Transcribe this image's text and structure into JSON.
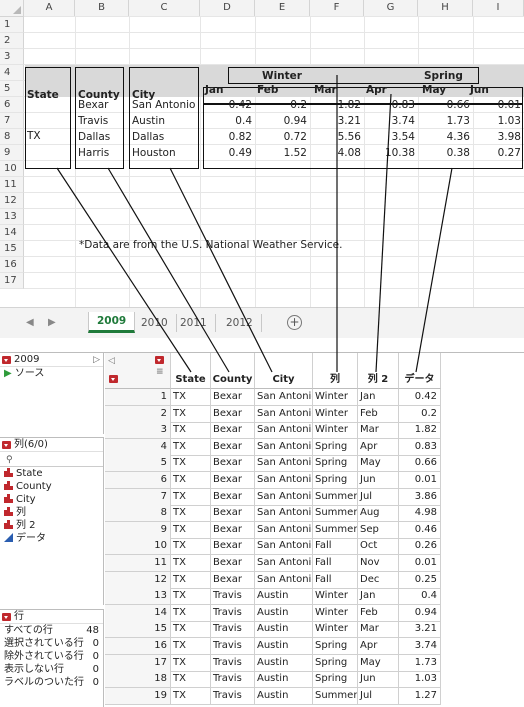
{
  "sheet": {
    "columns": [
      "A",
      "B",
      "C",
      "D",
      "E",
      "F",
      "G",
      "H",
      "I"
    ],
    "rows": [
      "1",
      "2",
      "3",
      "4",
      "5",
      "6",
      "7",
      "8",
      "9",
      "10",
      "11",
      "12",
      "13",
      "14",
      "15",
      "16",
      "17"
    ],
    "header_state": "State",
    "header_county": "County",
    "header_city": "City",
    "season_winter": "Winter",
    "season_spring": "Spring",
    "months": [
      "Jan",
      "Feb",
      "Mar",
      "Apr",
      "May",
      "Jun"
    ],
    "state_value": "TX",
    "records": [
      {
        "county": "Bexar",
        "city": "San Antonio",
        "values": [
          "0.42",
          "0.2",
          "1.82",
          "0.83",
          "0.66",
          "0.01"
        ]
      },
      {
        "county": "Travis",
        "city": "Austin",
        "values": [
          "0.4",
          "0.94",
          "3.21",
          "3.74",
          "1.73",
          "1.03"
        ]
      },
      {
        "county": "Dallas",
        "city": "Dallas",
        "values": [
          "0.82",
          "0.72",
          "5.56",
          "3.54",
          "4.36",
          "3.98"
        ]
      },
      {
        "county": "Harris",
        "city": "Houston",
        "values": [
          "0.49",
          "1.52",
          "4.08",
          "10.38",
          "0.38",
          "0.27"
        ]
      }
    ],
    "note": "*Data are from the U.S. National Weather Service.",
    "tabs": [
      "2009",
      "2010",
      "2011",
      "2012"
    ],
    "active_tab": "2009",
    "add_tab_symbol": "+"
  },
  "jmp": {
    "table_name": "2009",
    "source_label": "ソース",
    "columns_panel_title": "列(6/0)",
    "column_list": [
      {
        "name": "State",
        "type": "nominal"
      },
      {
        "name": "County",
        "type": "nominal"
      },
      {
        "name": "City",
        "type": "nominal"
      },
      {
        "name": "列",
        "type": "nominal"
      },
      {
        "name": "列 2",
        "type": "nominal"
      },
      {
        "name": "データ",
        "type": "continuous"
      }
    ],
    "rows_panel_title": "行",
    "row_stats": [
      {
        "label": "すべての行",
        "value": "48"
      },
      {
        "label": "選択されている行",
        "value": "0"
      },
      {
        "label": "除外されている行",
        "value": "0"
      },
      {
        "label": "表示しない行",
        "value": "0"
      },
      {
        "label": "ラベルのついた行",
        "value": "0"
      }
    ],
    "grid_headers": [
      "State",
      "County",
      "City",
      "列",
      "列 2",
      "データ"
    ],
    "grid_rows": [
      [
        "1",
        "TX",
        "Bexar",
        "San Antonio",
        "Winter",
        "Jan",
        "0.42"
      ],
      [
        "2",
        "TX",
        "Bexar",
        "San Antonio",
        "Winter",
        "Feb",
        "0.2"
      ],
      [
        "3",
        "TX",
        "Bexar",
        "San Antonio",
        "Winter",
        "Mar",
        "1.82"
      ],
      [
        "4",
        "TX",
        "Bexar",
        "San Antonio",
        "Spring",
        "Apr",
        "0.83"
      ],
      [
        "5",
        "TX",
        "Bexar",
        "San Antonio",
        "Spring",
        "May",
        "0.66"
      ],
      [
        "6",
        "TX",
        "Bexar",
        "San Antonio",
        "Spring",
        "Jun",
        "0.01"
      ],
      [
        "7",
        "TX",
        "Bexar",
        "San Antonio",
        "Summer",
        "Jul",
        "3.86"
      ],
      [
        "8",
        "TX",
        "Bexar",
        "San Antonio",
        "Summer",
        "Aug",
        "4.98"
      ],
      [
        "9",
        "TX",
        "Bexar",
        "San Antonio",
        "Summer",
        "Sep",
        "0.46"
      ],
      [
        "10",
        "TX",
        "Bexar",
        "San Antonio",
        "Fall",
        "Oct",
        "0.26"
      ],
      [
        "11",
        "TX",
        "Bexar",
        "San Antonio",
        "Fall",
        "Nov",
        "0.01"
      ],
      [
        "12",
        "TX",
        "Bexar",
        "San Antonio",
        "Fall",
        "Dec",
        "0.25"
      ],
      [
        "13",
        "TX",
        "Travis",
        "Austin",
        "Winter",
        "Jan",
        "0.4"
      ],
      [
        "14",
        "TX",
        "Travis",
        "Austin",
        "Winter",
        "Feb",
        "0.94"
      ],
      [
        "15",
        "TX",
        "Travis",
        "Austin",
        "Winter",
        "Mar",
        "3.21"
      ],
      [
        "16",
        "TX",
        "Travis",
        "Austin",
        "Spring",
        "Apr",
        "3.74"
      ],
      [
        "17",
        "TX",
        "Travis",
        "Austin",
        "Spring",
        "May",
        "1.73"
      ],
      [
        "18",
        "TX",
        "Travis",
        "Austin",
        "Spring",
        "Jun",
        "1.03"
      ],
      [
        "19",
        "TX",
        "Travis",
        "Austin",
        "Summer",
        "Jul",
        "1.27"
      ]
    ]
  },
  "colors": {
    "accent_green": "#1f7a3a",
    "nominal_red": "#c0282d",
    "continuous_blue": "#2a5db0",
    "header_band": "#d9d9d9"
  }
}
